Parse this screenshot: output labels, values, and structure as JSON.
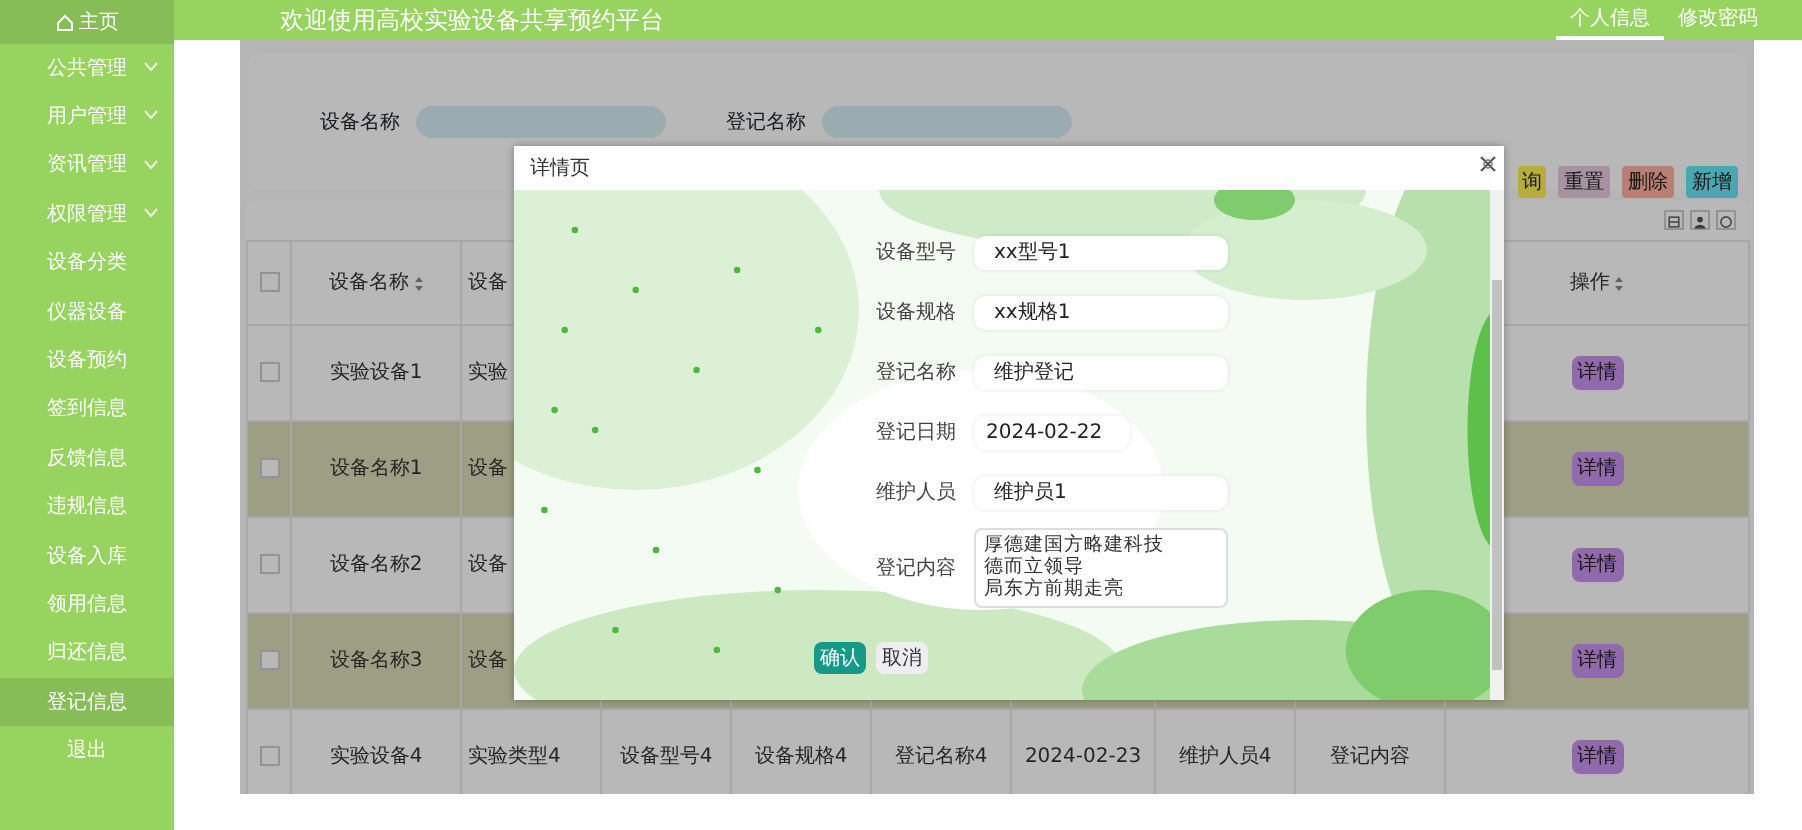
{
  "sidebar": {
    "home": {
      "label": "主页"
    },
    "items": [
      {
        "label": "公共管理",
        "expandable": true,
        "selected": false
      },
      {
        "label": "用户管理",
        "expandable": true,
        "selected": false
      },
      {
        "label": "资讯管理",
        "expandable": true,
        "selected": false
      },
      {
        "label": "权限管理",
        "expandable": true,
        "selected": false
      },
      {
        "label": "设备分类",
        "expandable": false,
        "selected": false
      },
      {
        "label": "仪器设备",
        "expandable": false,
        "selected": false
      },
      {
        "label": "设备预约",
        "expandable": false,
        "selected": false
      },
      {
        "label": "签到信息",
        "expandable": false,
        "selected": false
      },
      {
        "label": "反馈信息",
        "expandable": false,
        "selected": false
      },
      {
        "label": "违规信息",
        "expandable": false,
        "selected": false
      },
      {
        "label": "设备入库",
        "expandable": false,
        "selected": false
      },
      {
        "label": "领用信息",
        "expandable": false,
        "selected": false
      },
      {
        "label": "归还信息",
        "expandable": false,
        "selected": false
      },
      {
        "label": "登记信息",
        "expandable": false,
        "selected": true
      },
      {
        "label": "退出",
        "expandable": false,
        "selected": false
      }
    ]
  },
  "header": {
    "title": "欢迎使用高校实验设备共享预约平台",
    "links": [
      {
        "label": "个人信息",
        "selected": true
      },
      {
        "label": "修改密码",
        "selected": false
      }
    ]
  },
  "search": {
    "fields": [
      {
        "label": "设备名称"
      },
      {
        "label": "登记名称"
      }
    ],
    "buttons": [
      {
        "label": "询",
        "kind": "search"
      },
      {
        "label": "重置",
        "kind": "reset"
      },
      {
        "label": "删除",
        "kind": "delete"
      },
      {
        "label": "新增",
        "kind": "add"
      }
    ]
  },
  "table": {
    "columns": [
      {
        "label": "设备名称",
        "sortable": true
      },
      {
        "label": "设备",
        "sortable": false
      }
    ],
    "action_column": {
      "label": "操作",
      "sortable": true
    },
    "header_checked": false,
    "rows": [
      {
        "checked": false,
        "highlighted": false,
        "cells": [
          "实验设备1",
          "实验"
        ],
        "action": "详情"
      },
      {
        "checked": false,
        "highlighted": true,
        "cells": [
          "设备名称1",
          "设备"
        ],
        "action": "详情"
      },
      {
        "checked": false,
        "highlighted": false,
        "cells": [
          "设备名称2",
          "设备"
        ],
        "action": "详情"
      },
      {
        "checked": false,
        "highlighted": true,
        "cells": [
          "设备名称3",
          "设备"
        ],
        "action": "详情"
      },
      {
        "checked": false,
        "highlighted": false,
        "cells": [
          "实验设备4",
          "实验类型4",
          "设备型号4",
          "设备规格4",
          "登记名称4",
          "2024-02-23",
          "维护人员4",
          "登记内容"
        ],
        "action": "详情"
      }
    ]
  },
  "modal": {
    "title": "详情页",
    "fields": [
      {
        "label": "设备型号",
        "kind": "input",
        "value": "xx型号1"
      },
      {
        "label": "设备规格",
        "kind": "input",
        "value": "xx规格1"
      },
      {
        "label": "登记名称",
        "kind": "input",
        "value": "维护登记"
      },
      {
        "label": "登记日期",
        "kind": "date",
        "value": "2024-02-22"
      },
      {
        "label": "维护人员",
        "kind": "input",
        "value": "维护员1"
      },
      {
        "label": "登记内容",
        "kind": "textarea",
        "lines": [
          "厚德建国方略建科技",
          "德而立领导",
          "局东方前期走亮"
        ]
      }
    ],
    "buttons": [
      {
        "label": "确认",
        "kind": "primary"
      },
      {
        "label": "取消",
        "kind": "secondary"
      }
    ]
  }
}
